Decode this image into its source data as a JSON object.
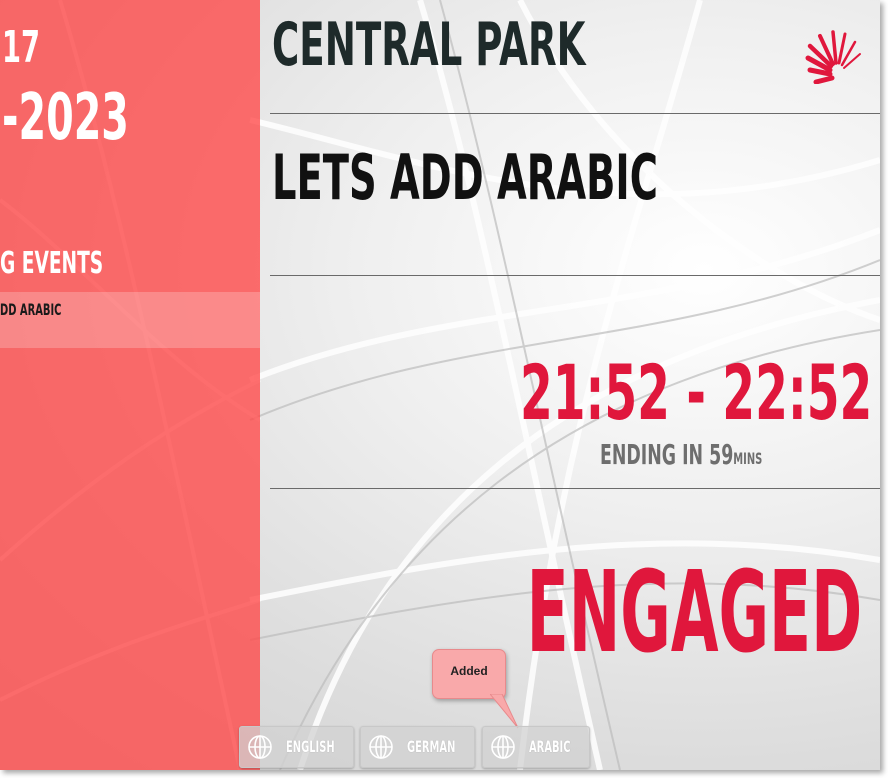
{
  "left_panel": {
    "date_day": "17",
    "date_year": "-2023",
    "upcoming_heading": "G EVENTS",
    "upcoming_items": [
      "DD ARABIC"
    ]
  },
  "room": {
    "name": "CENTRAL PARK",
    "logo_icon": "brand-sunburst-logo"
  },
  "meeting": {
    "title": "LETS ADD ARABIC",
    "time_range": "21:52 - 22:52",
    "ending_prefix": "ENDING IN ",
    "ending_value": "59",
    "ending_unit": "MINS",
    "status": "ENGAGED"
  },
  "tooltip": {
    "text": "Added"
  },
  "languages": [
    {
      "label": "ENGLISH",
      "icon": "globe-icon"
    },
    {
      "label": "GERMAN",
      "icon": "globe-icon"
    },
    {
      "label": "ARABIC",
      "icon": "globe-icon"
    }
  ],
  "colors": {
    "accent_red": "#e0173c",
    "panel_red": "#ff4646",
    "room_name": "#1e2a2a",
    "ending_gray": "#6e6e6e",
    "tooltip_bg": "#f9a9aa"
  }
}
